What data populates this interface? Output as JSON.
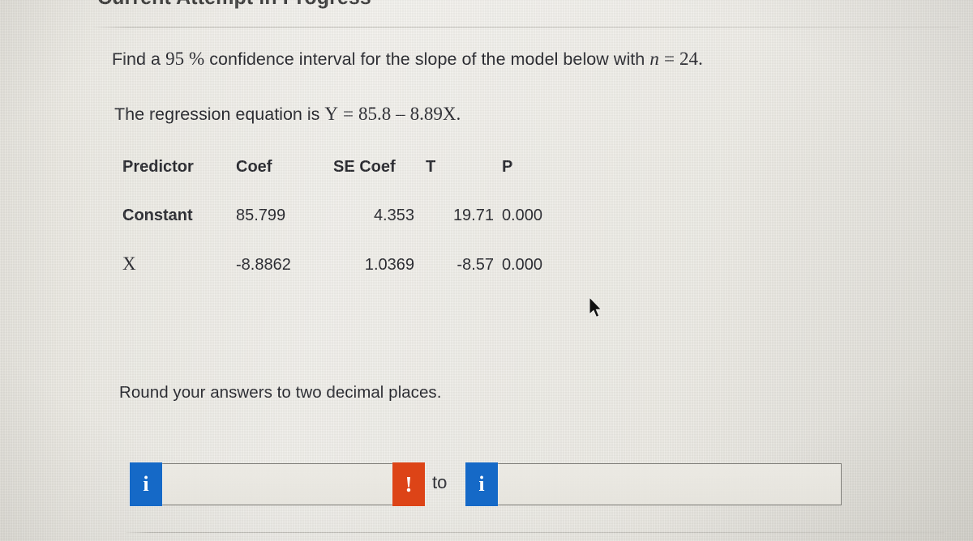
{
  "page": {
    "attempt_title": "Current Attempt in Progress",
    "prompt": {
      "before_percent": "Find a",
      "confidence_level": "95 %",
      "after_percent": "confidence interval for the slope of the model below with",
      "sample_var": "n",
      "sample_eq": "=",
      "sample_size": "24."
    },
    "equation": {
      "lead": "The regression equation is",
      "response_var": "Y",
      "equals": "=",
      "intercept": "85.8",
      "minus": "–",
      "slope_term": "8.89X."
    },
    "instruction": "Round your answers to two decimal places."
  },
  "stats_table": {
    "headers": [
      "Predictor",
      "Coef",
      "SE Coef",
      "T",
      "P"
    ],
    "rows": [
      {
        "predictor": "Constant",
        "coef": "85.799",
        "se_coef": "4.353",
        "t": "19.71",
        "p": "0.000",
        "label_style": "sans"
      },
      {
        "predictor": "X",
        "coef": "-8.8862",
        "se_coef": "1.0369",
        "t": "-8.57",
        "p": "0.000",
        "label_style": "serif"
      }
    ]
  },
  "answer": {
    "lower_bound": {
      "value": "",
      "placeholder": "",
      "info_badge": "i",
      "error_badge": "!"
    },
    "separator": "to",
    "upper_bound": {
      "value": "",
      "placeholder": "",
      "info_badge": "i"
    }
  },
  "colors": {
    "info_badge": "#1569c7",
    "error_badge": "#dd4417",
    "text": "#23242a",
    "page_background": "#e9e7e1"
  }
}
